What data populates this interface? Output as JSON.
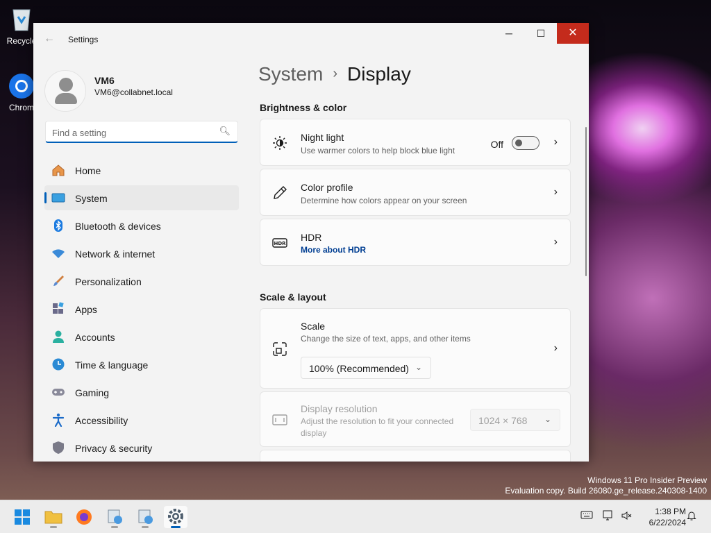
{
  "desktop": {
    "icons": [
      {
        "label": "Recycle",
        "icon": "recycle-bin-icon"
      },
      {
        "label": "Chrom",
        "icon": "chrome-icon"
      }
    ],
    "watermark": {
      "line1": "Windows 11 Pro Insider Preview",
      "line2": "Evaluation copy. Build 26080.ge_release.240308-1400"
    }
  },
  "window": {
    "title": "Settings",
    "controls": {
      "minimize": "─",
      "maximize": "☐",
      "close": "✕"
    }
  },
  "profile": {
    "name": "VM6",
    "email": "VM6@collabnet.local"
  },
  "search": {
    "placeholder": "Find a setting"
  },
  "nav": {
    "items": [
      {
        "label": "Home",
        "icon": "home-icon"
      },
      {
        "label": "System",
        "icon": "system-icon",
        "selected": true
      },
      {
        "label": "Bluetooth & devices",
        "icon": "bluetooth-icon"
      },
      {
        "label": "Network & internet",
        "icon": "wifi-icon"
      },
      {
        "label": "Personalization",
        "icon": "brush-icon"
      },
      {
        "label": "Apps",
        "icon": "apps-icon"
      },
      {
        "label": "Accounts",
        "icon": "account-icon"
      },
      {
        "label": "Time & language",
        "icon": "globe-clock-icon"
      },
      {
        "label": "Gaming",
        "icon": "gamepad-icon"
      },
      {
        "label": "Accessibility",
        "icon": "accessibility-icon"
      },
      {
        "label": "Privacy & security",
        "icon": "shield-icon"
      }
    ]
  },
  "content": {
    "breadcrumb": {
      "parent": "System",
      "current": "Display"
    },
    "sections": {
      "brightness": "Brightness & color",
      "scale": "Scale & layout"
    },
    "night_light": {
      "title": "Night light",
      "desc": "Use warmer colors to help block blue light",
      "state": "Off"
    },
    "color_profile": {
      "title": "Color profile",
      "desc": "Determine how colors appear on your screen"
    },
    "hdr": {
      "title": "HDR",
      "link": "More about HDR"
    },
    "scale": {
      "title": "Scale",
      "desc": "Change the size of text, apps, and other items",
      "value": "100% (Recommended)"
    },
    "resolution": {
      "title": "Display resolution",
      "desc": "Adjust the resolution to fit your connected display",
      "value": "1024 × 768"
    }
  },
  "taskbar": {
    "time": "1:38 PM",
    "date": "6/22/2024"
  },
  "colors": {
    "accent": "#005fb8",
    "close_red": "#c42b1c",
    "link": "#003e92"
  }
}
